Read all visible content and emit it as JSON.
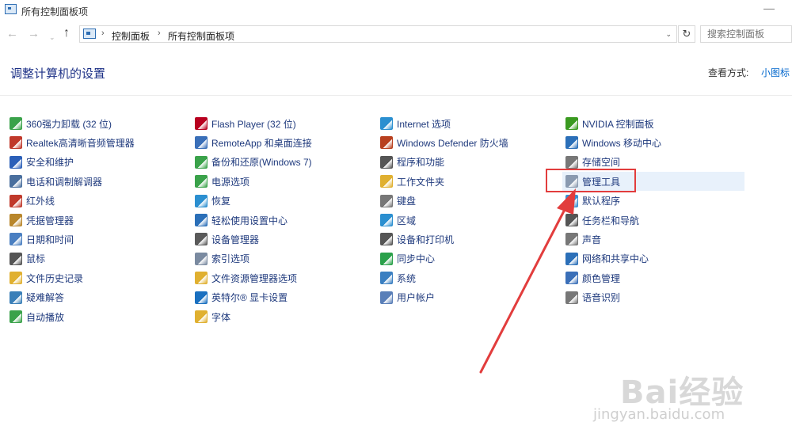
{
  "window": {
    "title": "所有控制面板项",
    "minimize": "—"
  },
  "nav": {
    "back": "←",
    "forward": "→",
    "recent": "⌄",
    "up": "↑"
  },
  "address": {
    "crumbs": [
      "控制面板",
      "所有控制面板项"
    ],
    "dropdown": "⌄",
    "refresh": "↻"
  },
  "search": {
    "placeholder": "搜索控制面板"
  },
  "header": {
    "title": "调整计算机的设置",
    "view_by_label": "查看方式:",
    "view_by_value": "小图标"
  },
  "items": {
    "col1": [
      "360强力卸载 (32 位)",
      "Realtek高清晰音频管理器",
      "安全和维护",
      "电话和调制解调器",
      "红外线",
      "凭据管理器",
      "日期和时间",
      "鼠标",
      "文件历史记录",
      "疑难解答",
      "自动播放"
    ],
    "col2": [
      "Flash Player (32 位)",
      "RemoteApp 和桌面连接",
      "备份和还原(Windows 7)",
      "电源选项",
      "恢复",
      "轻松使用设置中心",
      "设备管理器",
      "索引选项",
      "文件资源管理器选项",
      "英特尔® 显卡设置",
      "字体"
    ],
    "col3": [
      "Internet 选项",
      "Windows Defender 防火墙",
      "程序和功能",
      "工作文件夹",
      "键盘",
      "区域",
      "设备和打印机",
      "同步中心",
      "系统",
      "用户帐户"
    ],
    "col4": [
      "NVIDIA 控制面板",
      "Windows 移动中心",
      "存储空间",
      "管理工具",
      "默认程序",
      "任务栏和导航",
      "声音",
      "网络和共享中心",
      "颜色管理",
      "语音识别"
    ]
  },
  "icons": {
    "col1": [
      "app-uninstall-icon",
      "speaker-icon",
      "flag-icon",
      "phone-modem-icon",
      "infrared-icon",
      "credential-icon",
      "clock-icon",
      "mouse-icon",
      "file-history-icon",
      "troubleshoot-icon",
      "autoplay-icon"
    ],
    "col2": [
      "flash-icon",
      "remote-desktop-icon",
      "backup-icon",
      "power-icon",
      "recovery-icon",
      "ease-of-access-icon",
      "device-manager-icon",
      "index-icon",
      "folder-options-icon",
      "intel-graphics-icon",
      "font-icon"
    ],
    "col3": [
      "internet-options-icon",
      "firewall-icon",
      "programs-icon",
      "work-folders-icon",
      "keyboard-icon",
      "region-icon",
      "printer-icon",
      "sync-icon",
      "system-icon",
      "user-accounts-icon"
    ],
    "col4": [
      "nvidia-icon",
      "mobility-center-icon",
      "storage-icon",
      "admin-tools-icon",
      "default-programs-icon",
      "taskbar-icon",
      "sound-icon",
      "network-icon",
      "color-management-icon",
      "speech-icon"
    ]
  },
  "colors": {
    "link": "#1f3a7d",
    "title": "#1e3287",
    "annotation": "#e23d3d",
    "col1": [
      "#3aa24a",
      "#c0392b",
      "#2b5fb8",
      "#4a6f9e",
      "#c0392b",
      "#b8862b",
      "#4a7fc1",
      "#555555",
      "#e0b030",
      "#3a7fb8",
      "#3aa24a"
    ],
    "col2": [
      "#b8001f",
      "#3a6fb8",
      "#3aa24a",
      "#3aa24a",
      "#2b8fd0",
      "#2b6fb8",
      "#5a5a5a",
      "#7a8aa0",
      "#e0b030",
      "#1a70c0",
      "#e0b030"
    ],
    "col3": [
      "#2b8fd0",
      "#b8401f",
      "#555555",
      "#e0b030",
      "#777777",
      "#2b8fd0",
      "#555555",
      "#2aa04a",
      "#3a7fc1",
      "#5a7fb8"
    ],
    "col4": [
      "#3a9a20",
      "#2b6fb8",
      "#777777",
      "#8a9ab0",
      "#3a8fd0",
      "#555555",
      "#777777",
      "#2b6fb8",
      "#3a6fb8",
      "#777777"
    ]
  },
  "watermark": {
    "brand": "Bai经验",
    "sub": "jingyan.baidu.com"
  }
}
